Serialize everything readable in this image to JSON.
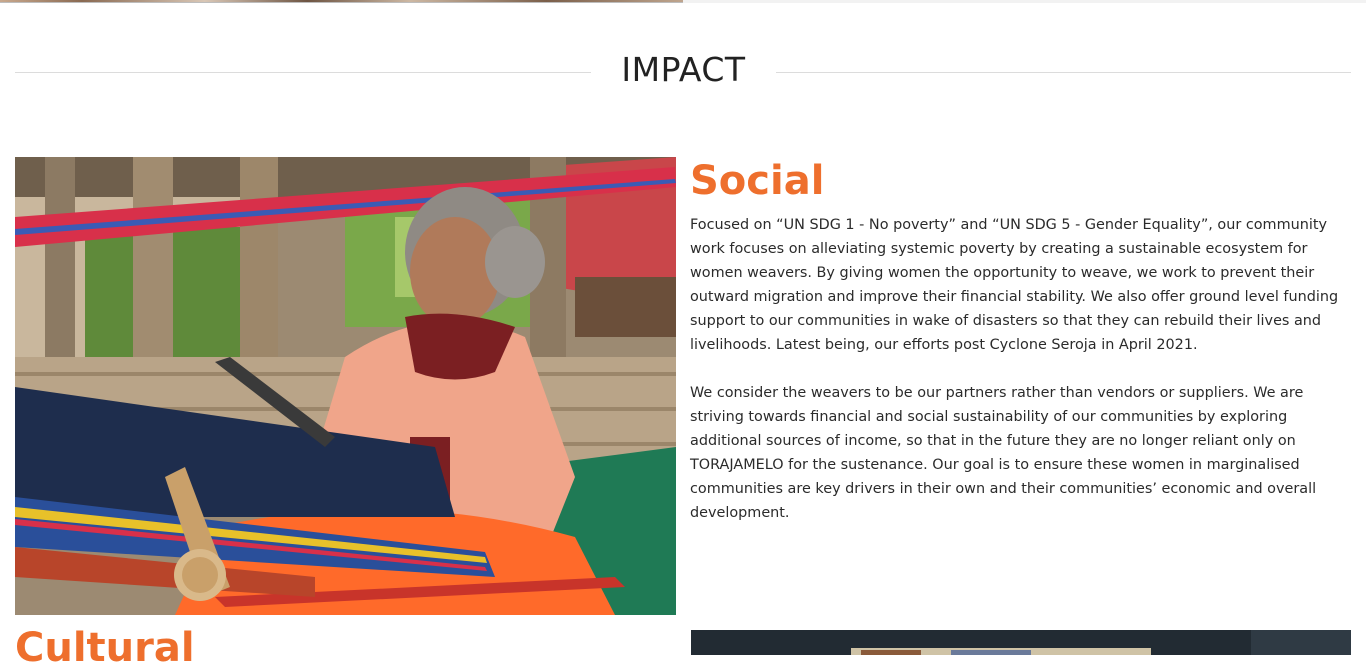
{
  "impact": {
    "heading": "IMPACT"
  },
  "social": {
    "title": "Social",
    "paragraphs": [
      "Focused on “UN SDG 1 - No poverty” and “UN SDG 5 - Gender Equality”, our community work focuses on alleviating systemic poverty by creating a sustainable ecosystem for women weavers. By giving women the opportunity to weave, we work to prevent their outward migration and improve their financial stability. We also offer ground level funding support to our communities in wake of disasters so that they can rebuild their lives and livelihoods. Latest being, our efforts post Cyclone Seroja in April 2021.",
      "We consider the weavers to be our partners rather than vendors or suppliers. We are striving towards financial and social sustainability of our communities by exploring additional sources of income, so that in the future they are no longer reliant only on TORAJAMELO for the sustenance. Our goal is to ensure these women in marginalised communities are key drivers in their own and their communities’ economic and overall development."
    ],
    "image_icon": "weaver-photo"
  },
  "cultural": {
    "title": "Cultural",
    "image_icon": "textile-photo"
  },
  "colors": {
    "accent": "#ee6f2d",
    "text": "#2b2b2b",
    "heading": "#222222",
    "rule": "#dcdcdc"
  }
}
